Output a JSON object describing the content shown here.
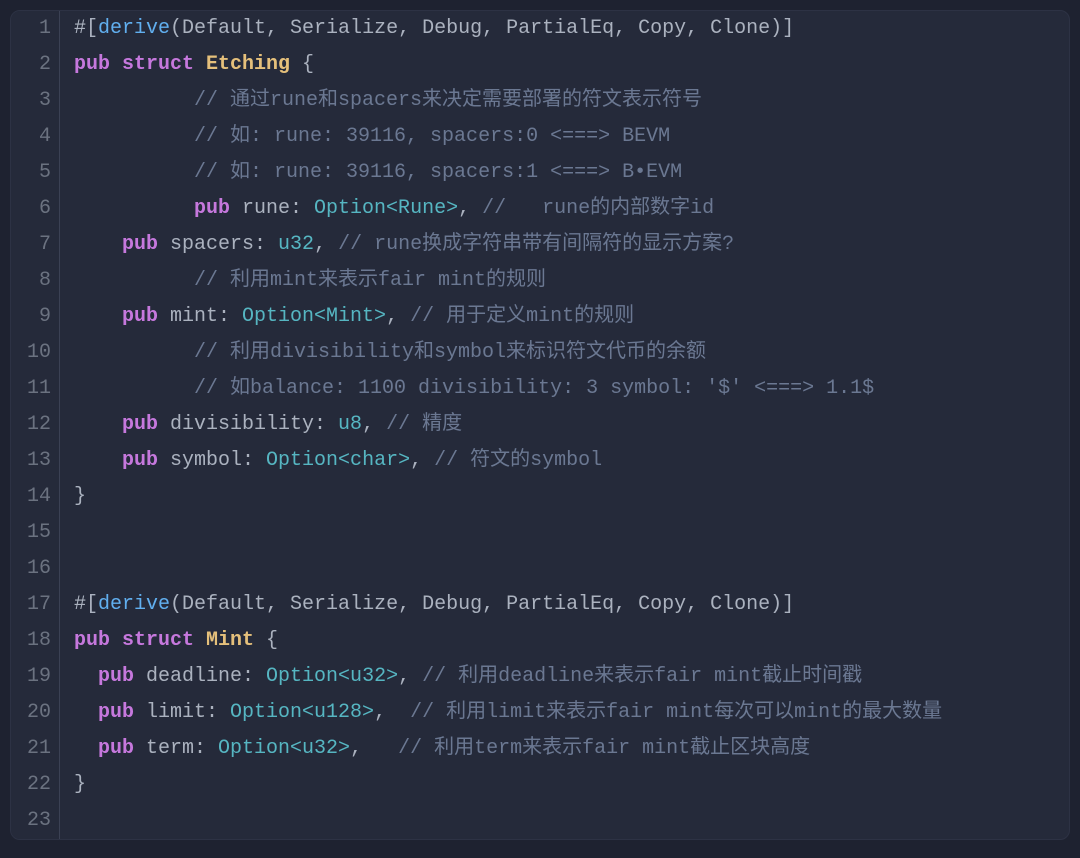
{
  "lineNumbers": [
    "1",
    "2",
    "3",
    "4",
    "5",
    "6",
    "7",
    "8",
    "9",
    "10",
    "11",
    "12",
    "13",
    "14",
    "15",
    "16",
    "17",
    "18",
    "19",
    "20",
    "21",
    "22",
    "23"
  ],
  "code": {
    "l1_p1": "#[",
    "l1_derive": "derive",
    "l1_p2": "(Default, Serialize, Debug, PartialEq, Copy, Clone)]",
    "l2_pub": "pub",
    "l2_struct": " struct",
    "l2_name": " Etching",
    "l2_brace": " {",
    "l3_cm": "          // 通过rune和spacers来决定需要部署的符文表示符号",
    "l4_cm": "          // 如: rune: 39116, spacers:0 <===> BEVM",
    "l5_cm": "          // 如: rune: 39116, spacers:1 <===> B•EVM",
    "l6_pub": "          pub",
    "l6_field": " rune: ",
    "l6_ty": "Option<Rune>",
    "l6_comma": ",",
    "l6_cm": " //   rune的内部数字id",
    "l7_pub": "    pub",
    "l7_field": " spacers: ",
    "l7_ty": "u32",
    "l7_comma": ",",
    "l7_cm": " // rune换成字符串带有间隔符的显示方案?",
    "l8_cm": "          // 利用mint来表示fair mint的规则",
    "l9_pub": "    pub",
    "l9_field": " mint: ",
    "l9_ty": "Option<Mint>",
    "l9_comma": ",",
    "l9_cm": " // 用于定义mint的规则",
    "l10_cm": "          // 利用divisibility和symbol来标识符文代币的余额",
    "l11_cm": "          // 如balance: 1100 divisibility: 3 symbol: '$' <===> 1.1$",
    "l12_pub": "    pub",
    "l12_field": " divisibility: ",
    "l12_ty": "u8",
    "l12_comma": ",",
    "l12_cm": " // 精度",
    "l13_pub": "    pub",
    "l13_field": " symbol: ",
    "l13_ty": "Option<char>",
    "l13_comma": ",",
    "l13_cm": " // 符文的symbol",
    "l14_brace": "}",
    "l15": "",
    "l16": "",
    "l17_p1": "#[",
    "l17_derive": "derive",
    "l17_p2": "(Default, Serialize, Debug, PartialEq, Copy, Clone)]",
    "l18_pub": "pub",
    "l18_struct": " struct",
    "l18_name": " Mint",
    "l18_brace": " {",
    "l19_pub": "  pub",
    "l19_field": " deadline: ",
    "l19_ty": "Option<u32>",
    "l19_comma": ",",
    "l19_cm": " // 利用deadline来表示fair mint截止时间戳",
    "l20_pub": "  pub",
    "l20_field": " limit: ",
    "l20_ty": "Option<u128>",
    "l20_comma": ",",
    "l20_cm": "  // 利用limit来表示fair mint每次可以mint的最大数量",
    "l21_pub": "  pub",
    "l21_field": " term: ",
    "l21_ty": "Option<u32>",
    "l21_comma": ",",
    "l21_cm": "   // 利用term来表示fair mint截止区块高度",
    "l22_brace": "}",
    "l23": ""
  }
}
